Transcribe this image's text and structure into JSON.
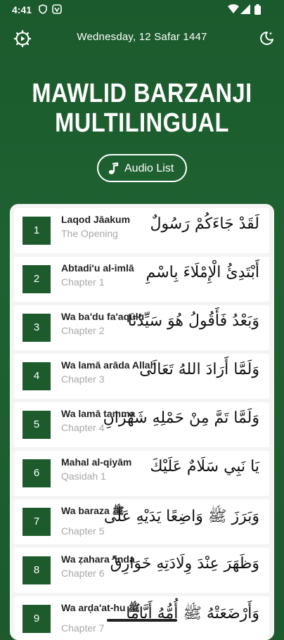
{
  "status": {
    "time": "4:41"
  },
  "header": {
    "date": "Wednesday, 12 Safar 1447",
    "title_line1": "MAWLID BARZANJI",
    "title_line2": "MULTILINGUAL",
    "audio_label": "Audio List"
  },
  "chapters": [
    {
      "num": "1",
      "title": "Laqod Jāakum",
      "sub": "The Opening",
      "arabic": "لَقَدْ جَاءَكُمْ رَسُولٌ"
    },
    {
      "num": "2",
      "title": "Abtadi'u al-imlā",
      "sub": "Chapter 1",
      "arabic": "أَبْتَدِئُ الْإِمْلَاءَ بِاسْمِ"
    },
    {
      "num": "3",
      "title": "Wa ba'du fa'aqūlu",
      "sub": "Chapter 2",
      "arabic": "وَبَعْدُ فَأَقُولُ هُوَ سَيِّدُنَا"
    },
    {
      "num": "4",
      "title": "Wa lamā arāda Allah",
      "sub": "Chapter 3",
      "arabic": "وَلَمَّا أَرَادَ اللهُ تَعَالَى"
    },
    {
      "num": "5",
      "title": "Wa lamā tamma",
      "sub": "Chapter 4",
      "arabic": "وَلَمَّا تَمَّ مِنْ حَمْلِهِ شَهْرَانِ"
    },
    {
      "num": "6",
      "title": "Mahal al-qiyām",
      "sub": "Qasidah 1",
      "arabic": "يَا نَبِي سَلَامٌ عَلَيْكَ"
    },
    {
      "num": "7",
      "title": "Wa baraza ﷺ",
      "sub": "Chapter 5",
      "arabic": "وَبَرَزَ ﷺ وَاضِعًا يَدَيْهِ عَلَى"
    },
    {
      "num": "8",
      "title": "Wa ẓahara 'inda",
      "sub": "Chapter 6",
      "arabic": "وَظَهَرَ عِنْدَ وِلَادَتِهِ خَوَارِقُ"
    },
    {
      "num": "9",
      "title": "Wa arḍa'at-hu ﷺ",
      "sub": "Chapter 7",
      "arabic": "وَأَرْضَعَتْهُ ﷺ أُمُّهُ أَيَّامًا"
    }
  ]
}
